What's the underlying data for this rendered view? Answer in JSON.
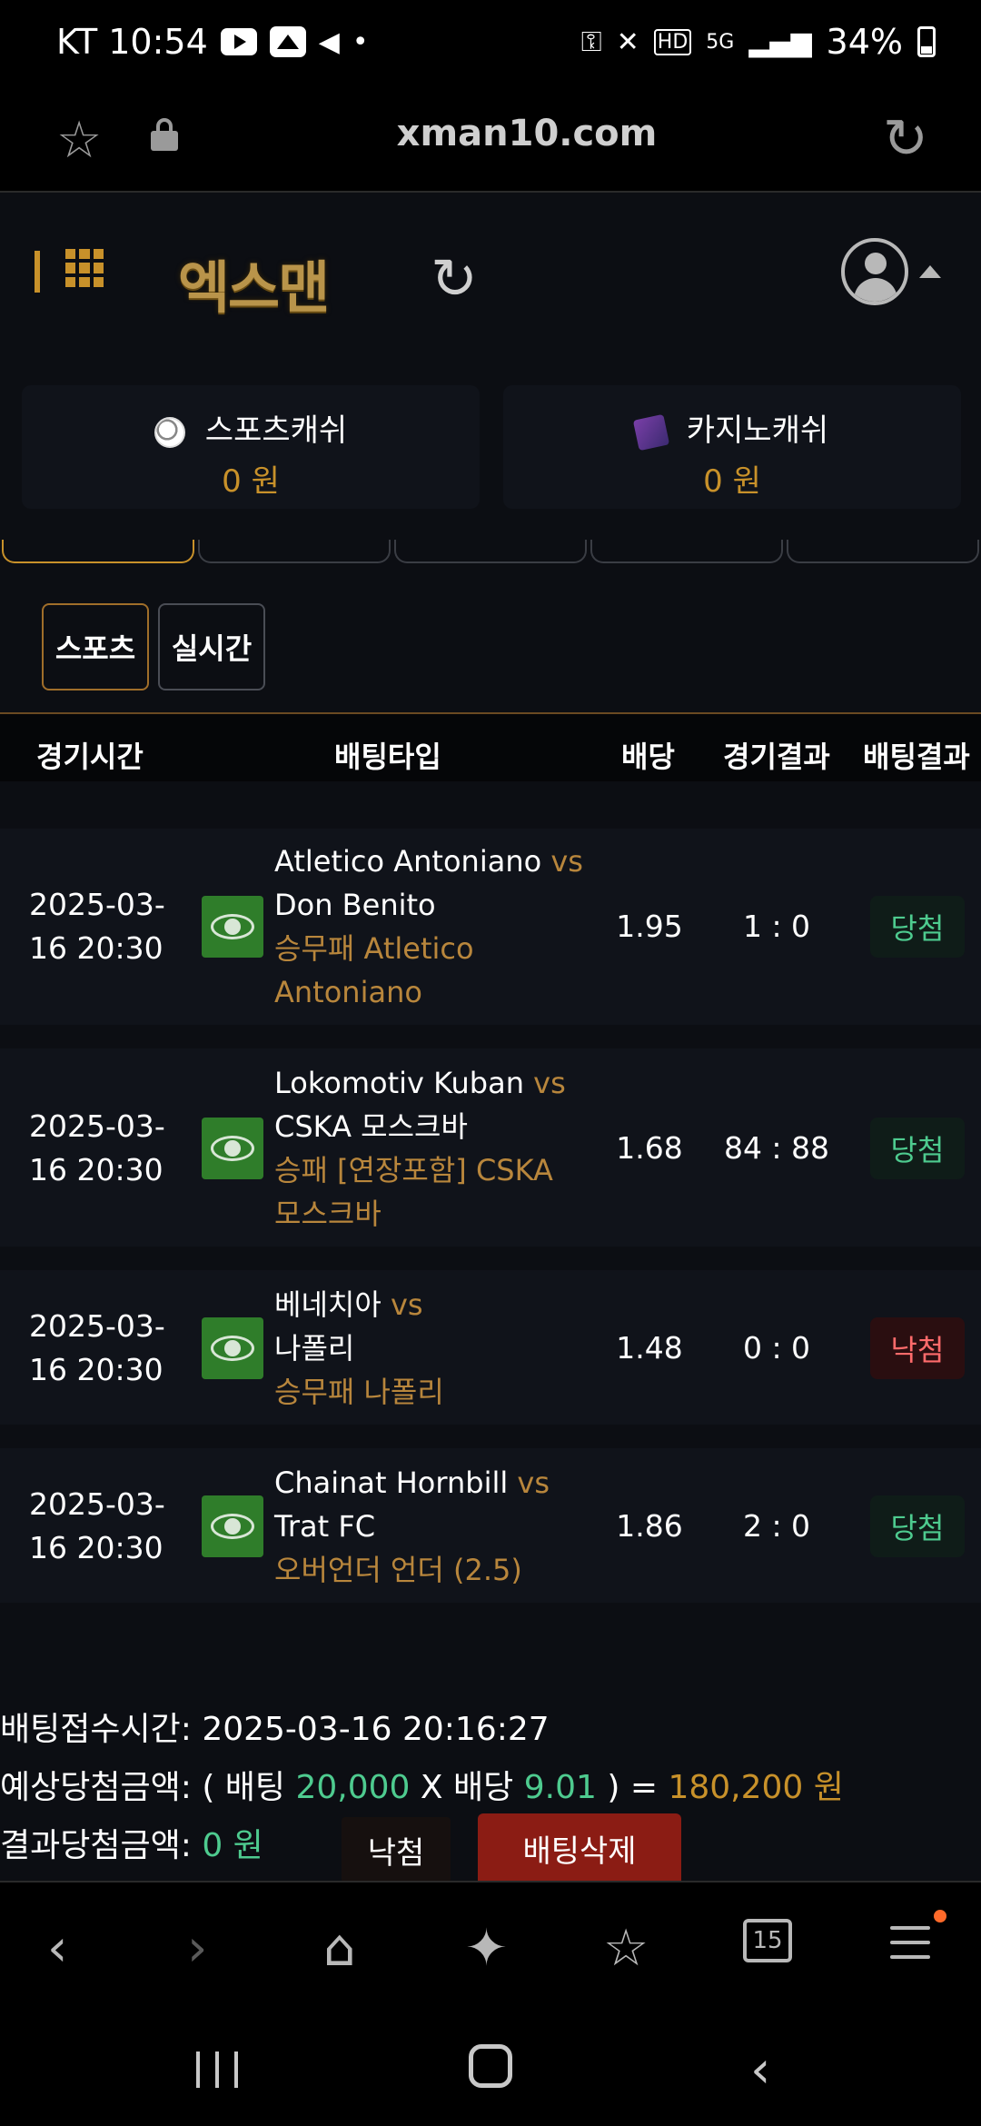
{
  "status": {
    "carrier_time": "KT 10:54",
    "battery": "34%",
    "network": "5G"
  },
  "browser": {
    "url": "xman10.com"
  },
  "site": {
    "logo_text": "엑스맨",
    "wallets": [
      {
        "label": "스포츠캐쉬",
        "amount": "0 원"
      },
      {
        "label": "카지노캐쉬",
        "amount": "0 원"
      }
    ],
    "filters": [
      "스포츠",
      "실시간"
    ],
    "table_headers": [
      "경기시간",
      "배팅타입",
      "배당",
      "경기결과",
      "배팅결과"
    ],
    "rows": [
      {
        "time_1": "2025-03-",
        "time_2": "16 20:30",
        "home": "Atletico Antoniano",
        "vs": "vs",
        "away": "Don Benito",
        "pick_1": "승무패 Atletico",
        "pick_2": "Antoniano",
        "odds": "1.95",
        "score": "1 : 0",
        "result": "당첨",
        "result_type": "win"
      },
      {
        "time_1": "2025-03-",
        "time_2": "16 20:30",
        "home": "Lokomotiv Kuban",
        "vs": "vs",
        "away": "CSKA 모스크바",
        "pick_1": "승패 [연장포함] CSKA",
        "pick_2": "모스크바",
        "odds": "1.68",
        "score": "84 : 88",
        "result": "당첨",
        "result_type": "win"
      },
      {
        "time_1": "2025-03-",
        "time_2": "16 20:30",
        "home": "베네치아",
        "vs": "vs",
        "away": "나폴리",
        "pick_1": "승무패 나폴리",
        "pick_2": "",
        "odds": "1.48",
        "score": "0 : 0",
        "result": "낙첨",
        "result_type": "lose"
      },
      {
        "time_1": "2025-03-",
        "time_2": "16 20:30",
        "home": "Chainat Hornbill",
        "vs": "vs",
        "away": "Trat FC",
        "pick_1": "오버언더 언더 (2.5)",
        "pick_2": "",
        "odds": "1.86",
        "score": "2 : 0",
        "result": "당첨",
        "result_type": "win"
      }
    ],
    "summary": {
      "accept_label": "배팅접수시간:",
      "accept_time": "2025-03-16 20:16:27",
      "expected_label": "예상당첨금액:",
      "open_paren": "( 배팅",
      "bet_amount": "20,000",
      "times": "X 배당",
      "total_odds": "9.01",
      "close_eq": ") =",
      "expected_amount": "180,200 원",
      "result_label": "결과당첨금액:",
      "result_amount": "0 원",
      "status_button": "낙첨",
      "delete_button": "배팅삭제"
    }
  }
}
